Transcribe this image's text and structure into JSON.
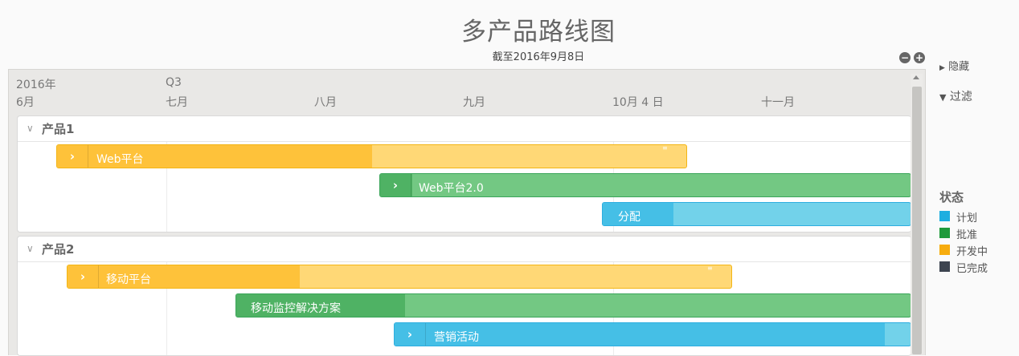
{
  "header": {
    "title": "多产品路线图",
    "subtitle": "截至2016年9月8日"
  },
  "timeline": {
    "year": "2016年",
    "quarter": "Q3",
    "months": [
      "6月",
      "七月",
      "八月",
      "九月",
      "10月 4 日",
      "十一月"
    ]
  },
  "groups": [
    {
      "name": "产品1",
      "bars": [
        {
          "label": "Web平台",
          "status": "开发中",
          "chevron": true,
          "progress": 0.5
        },
        {
          "label": "Web平台2.0",
          "status": "批准",
          "chevron": true,
          "progress": 0.06
        },
        {
          "label": "分配",
          "status": "计划",
          "chevron": false,
          "progress": 0.23
        }
      ]
    },
    {
      "name": "产品2",
      "bars": [
        {
          "label": "移动平台",
          "status": "开发中",
          "chevron": true,
          "progress": 0.35
        },
        {
          "label": "移动监控解决方案",
          "status": "批准",
          "chevron": false,
          "progress": 0.25
        },
        {
          "label": "营销活动",
          "status": "计划",
          "chevron": true,
          "progress": 0.95
        }
      ]
    }
  ],
  "sidebar": {
    "hide_label": "隐藏",
    "filter_label": "过滤"
  },
  "legend": {
    "title": "状态",
    "items": [
      {
        "label": "计划",
        "color": "#1eaee0"
      },
      {
        "label": "批准",
        "color": "#1f9a3b"
      },
      {
        "label": "开发中",
        "color": "#f7ac0e"
      },
      {
        "label": "已完成",
        "color": "#3d4450"
      }
    ]
  },
  "controls": {
    "zoom_out_symbol": "−",
    "zoom_in_symbol": "+"
  }
}
